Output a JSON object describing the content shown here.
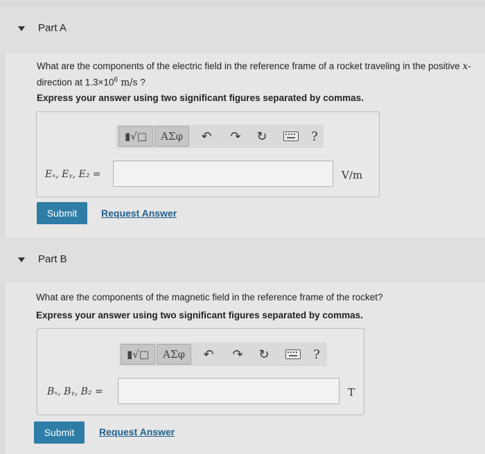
{
  "partA": {
    "title": "Part A",
    "question_pre": "What are the components of the electric field in the reference frame of a rocket traveling in the positive ",
    "question_var": "x",
    "question_mid": "-direction at 1.3×10",
    "question_exp": "6",
    "question_unit": " m/s",
    "question_end": " ?",
    "instruction": "Express your answer using two significant figures separated by commas.",
    "label": "Eₓ, Eᵧ, E₂ =",
    "unit": "V/m",
    "submit_label": "Submit",
    "request_label": "Request Answer"
  },
  "partB": {
    "title": "Part B",
    "question": "What are the components of the magnetic field in the reference frame of the rocket?",
    "instruction": "Express your answer using two significant figures separated by commas.",
    "label": "Bₓ, Bᵧ, B₂ =",
    "unit": "T",
    "submit_label": "Submit",
    "request_label": "Request Answer"
  },
  "toolbar": {
    "templates_label": "▮√□",
    "greek_label": "ΑΣφ",
    "help_label": "?"
  },
  "icons": [
    "undo-icon",
    "redo-icon",
    "reset-icon",
    "keyboard-icon",
    "help-icon"
  ]
}
